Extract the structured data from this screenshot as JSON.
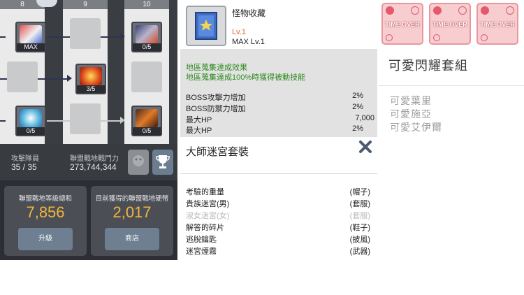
{
  "union_board": {
    "columns": [
      "8",
      "9",
      "10"
    ],
    "slots": {
      "col8_row1_caption": "MAX",
      "col8_row3_caption": "0/5",
      "col9_row2_caption": "3/5",
      "col10_row1_caption": "0/5",
      "col10_row3_caption": "0/5"
    },
    "stats": {
      "members_label": "攻擊隊員",
      "members_value": "35 / 35",
      "power_label": "聯盟戰地戰鬥力",
      "power_value": "273,744,344"
    },
    "level_card": {
      "label": "聯盟戰地等級總和",
      "value": "7,856",
      "button": "升級"
    },
    "coin_card": {
      "label": "目前獲得的聯盟戰地硬幣",
      "value": "2,017",
      "button": "商店"
    },
    "icons": [
      "trophy-icon",
      "monster-emblem-icon"
    ]
  },
  "collection": {
    "name": "怪物收藏",
    "level_current": "Lv.1",
    "level_max": "MAX Lv.1",
    "effect_title_1": "地區蒐集達成效果",
    "effect_title_2": "地區蒐集達成100%時獲得被動技能",
    "effects": [
      {
        "label": "BOSS攻擊力增加",
        "value": "2%"
      },
      {
        "label": "BOSS防禦力增加",
        "value": "2%"
      },
      {
        "label": "最大HP",
        "value": "7,000"
      },
      {
        "label": "最大HP",
        "value": "2%"
      }
    ]
  },
  "set": {
    "title": "大師迷宮套裝",
    "close_icon": "close-icon",
    "items": [
      {
        "name": "考驗的重量",
        "slot": "(帽子)",
        "dim": false
      },
      {
        "name": "貴族迷宮(男)",
        "slot": "(套服)",
        "dim": false
      },
      {
        "name": "淑女迷宮(女)",
        "slot": "(套服)",
        "dim": true
      },
      {
        "name": "解答的碎片",
        "slot": "(鞋子)",
        "dim": false
      },
      {
        "name": "逃脫鑰匙",
        "slot": "(披風)",
        "dim": false
      },
      {
        "name": "迷宮煙霧",
        "slot": "(武器)",
        "dim": false
      }
    ]
  },
  "cute_set": {
    "cards": [
      "TIME OVER",
      "TIME OVER",
      "TIME OVER"
    ],
    "title": "可愛閃耀套組",
    "items": [
      "可愛葉里",
      "可愛施亞",
      "可愛艾伊爾"
    ]
  },
  "colors": {
    "accent_orange": "#f3b53c",
    "level_red": "#e0652c",
    "effect_green": "#2e8b1f",
    "timeover_pink": "#f7cdd0"
  }
}
